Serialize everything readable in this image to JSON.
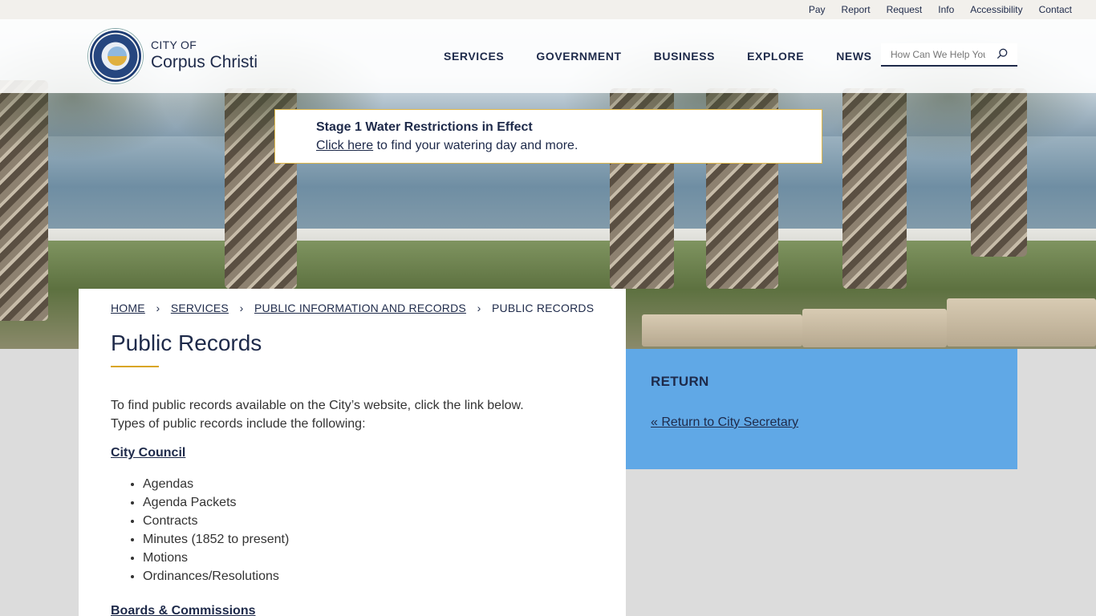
{
  "utility_nav": [
    "Pay",
    "Report",
    "Request",
    "Info",
    "Accessibility",
    "Contact"
  ],
  "logo": {
    "city_of": "CITY OF",
    "name": "Corpus Christi"
  },
  "main_nav": [
    "SERVICES",
    "GOVERNMENT",
    "BUSINESS",
    "EXPLORE",
    "NEWS"
  ],
  "search": {
    "placeholder": "How Can We Help You?"
  },
  "alert": {
    "title": "Stage 1 Water Restrictions in Effect",
    "link_text": "Click here",
    "rest_text": " to find your watering day and more."
  },
  "breadcrumb": {
    "items": [
      "HOME",
      "SERVICES",
      "PUBLIC INFORMATION AND RECORDS"
    ],
    "current": "PUBLIC RECORDS"
  },
  "page_title": "Public Records",
  "intro": {
    "line1": "To find public records available on the City’s website, click the link below.",
    "line2": "Types of public records include the following:"
  },
  "sections": [
    {
      "heading": "City Council",
      "items": [
        "Agendas",
        "Agenda Packets",
        "Contracts",
        "Minutes (1852 to present)",
        "Motions",
        "Ordinances/Resolutions"
      ]
    },
    {
      "heading": "Boards & Commissions"
    }
  ],
  "sidebar": {
    "heading": "RETURN",
    "link": "« Return to City Secretary"
  },
  "colors": {
    "navy": "#1e2a4a",
    "accent_gold": "#d9a520",
    "sidebar_blue": "#60a8e6",
    "alert_border": "#e0b84a"
  }
}
